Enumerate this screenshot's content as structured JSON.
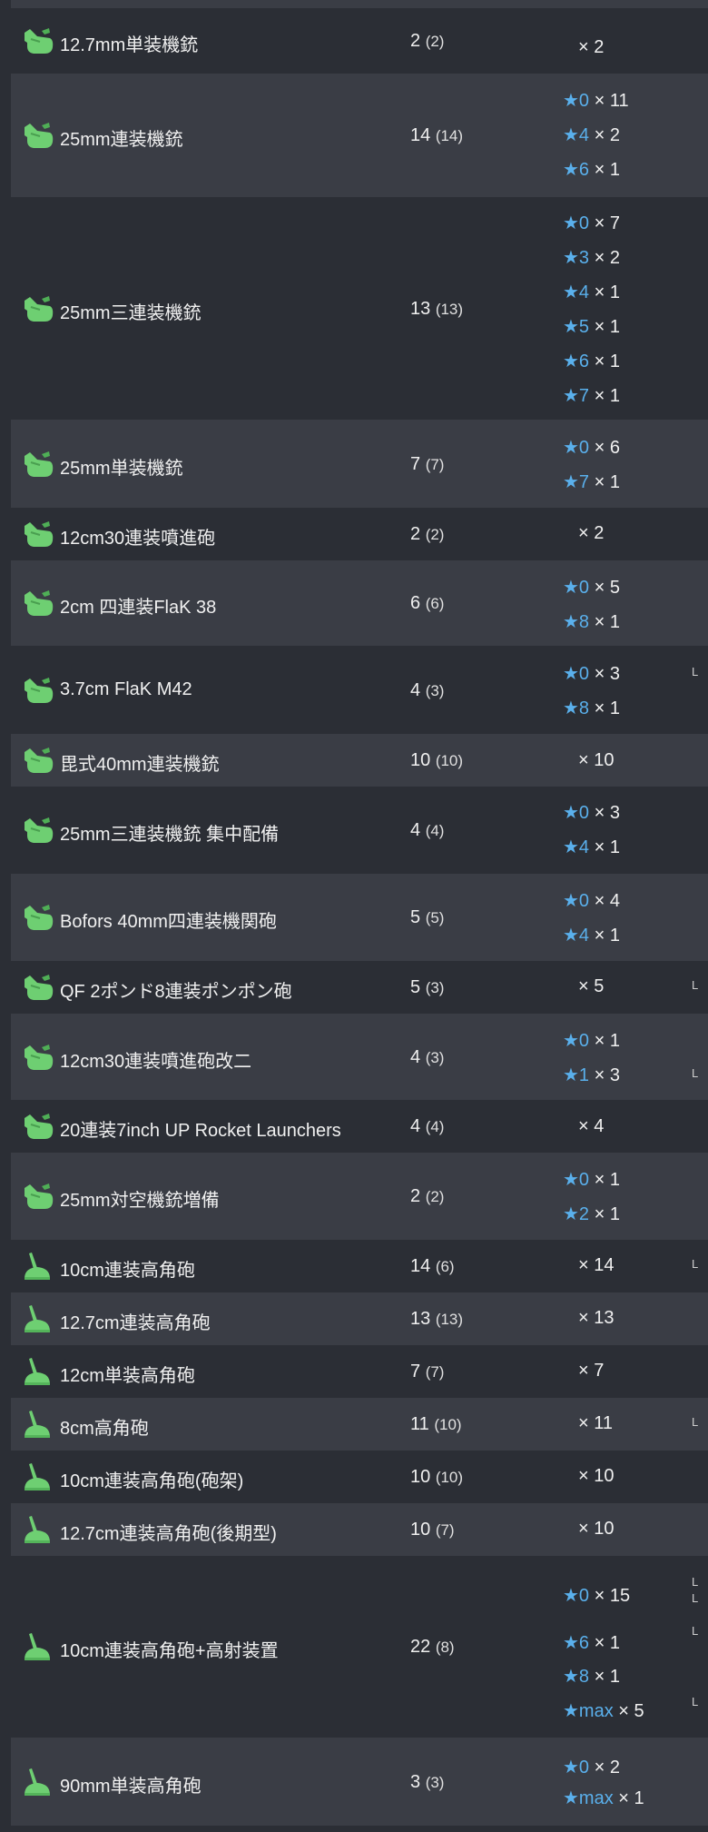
{
  "equipment": [
    {
      "name": "12.7mm単装機銃",
      "count": "2",
      "sub": "(2)",
      "icon": "machine-gun",
      "stars": [
        {
          "level": "",
          "mult": "× 2"
        }
      ]
    },
    {
      "name": "25mm連装機銃",
      "count": "14",
      "sub": "(14)",
      "icon": "machine-gun",
      "stars": [
        {
          "level": "★0",
          "mult": "× 11"
        },
        {
          "level": "★4",
          "mult": "× 2"
        },
        {
          "level": "★6",
          "mult": "× 1"
        }
      ]
    },
    {
      "name": "25mm三連装機銃",
      "count": "13",
      "sub": "(13)",
      "icon": "machine-gun",
      "stars": [
        {
          "level": "★0",
          "mult": "× 7"
        },
        {
          "level": "★3",
          "mult": "× 2"
        },
        {
          "level": "★4",
          "mult": "× 1"
        },
        {
          "level": "★5",
          "mult": "× 1"
        },
        {
          "level": "★6",
          "mult": "× 1"
        },
        {
          "level": "★7",
          "mult": "× 1"
        }
      ]
    },
    {
      "name": "25mm単装機銃",
      "count": "7",
      "sub": "(7)",
      "icon": "machine-gun",
      "stars": [
        {
          "level": "★0",
          "mult": "× 6"
        },
        {
          "level": "★7",
          "mult": "× 1"
        }
      ]
    },
    {
      "name": "12cm30連装噴進砲",
      "count": "2",
      "sub": "(2)",
      "icon": "machine-gun",
      "stars": [
        {
          "level": "",
          "mult": "× 2"
        }
      ]
    },
    {
      "name": "2cm 四連装FlaK 38",
      "count": "6",
      "sub": "(6)",
      "icon": "machine-gun",
      "stars": [
        {
          "level": "★0",
          "mult": "× 5"
        },
        {
          "level": "★8",
          "mult": "× 1"
        }
      ]
    },
    {
      "name": "3.7cm FlaK M42",
      "count": "4",
      "sub": "(3)",
      "icon": "machine-gun",
      "stars": [
        {
          "level": "★0",
          "mult": "× 3"
        },
        {
          "level": "★8",
          "mult": "× 1"
        }
      ]
    },
    {
      "name": "毘式40mm連装機銃",
      "count": "10",
      "sub": "(10)",
      "icon": "machine-gun",
      "stars": [
        {
          "level": "",
          "mult": "× 10"
        }
      ]
    },
    {
      "name": "25mm三連装機銃 集中配備",
      "count": "4",
      "sub": "(4)",
      "icon": "machine-gun",
      "stars": [
        {
          "level": "★0",
          "mult": "× 3"
        },
        {
          "level": "★4",
          "mult": "× 1"
        }
      ]
    },
    {
      "name": "Bofors 40mm四連装機関砲",
      "count": "5",
      "sub": "(5)",
      "icon": "machine-gun",
      "stars": [
        {
          "level": "★0",
          "mult": "× 4"
        },
        {
          "level": "★4",
          "mult": "× 1"
        }
      ]
    },
    {
      "name": "QF 2ポンド8連装ポンポン砲",
      "count": "5",
      "sub": "(3)",
      "icon": "machine-gun",
      "stars": [
        {
          "level": "",
          "mult": "× 5"
        }
      ]
    },
    {
      "name": "12cm30連装噴進砲改二",
      "count": "4",
      "sub": "(3)",
      "icon": "machine-gun",
      "stars": [
        {
          "level": "★0",
          "mult": "× 1"
        },
        {
          "level": "★1",
          "mult": "× 3"
        }
      ]
    },
    {
      "name": "20連装7inch UP Rocket Launchers",
      "count": "4",
      "sub": "(4)",
      "icon": "machine-gun",
      "stars": [
        {
          "level": "",
          "mult": "× 4"
        }
      ]
    },
    {
      "name": "25mm対空機銃増備",
      "count": "2",
      "sub": "(2)",
      "icon": "machine-gun",
      "stars": [
        {
          "level": "★0",
          "mult": "× 1"
        },
        {
          "level": "★2",
          "mult": "× 1"
        }
      ]
    },
    {
      "name": "10cm連装高角砲",
      "count": "14",
      "sub": "(6)",
      "icon": "high-angle-gun",
      "stars": [
        {
          "level": "",
          "mult": "× 14"
        }
      ]
    },
    {
      "name": "12.7cm連装高角砲",
      "count": "13",
      "sub": "(13)",
      "icon": "high-angle-gun",
      "stars": [
        {
          "level": "",
          "mult": "× 13"
        }
      ]
    },
    {
      "name": "12cm単装高角砲",
      "count": "7",
      "sub": "(7)",
      "icon": "high-angle-gun",
      "stars": [
        {
          "level": "",
          "mult": "× 7"
        }
      ]
    },
    {
      "name": "8cm高角砲",
      "count": "11",
      "sub": "(10)",
      "icon": "high-angle-gun",
      "stars": [
        {
          "level": "",
          "mult": "× 11"
        }
      ]
    },
    {
      "name": "10cm連装高角砲(砲架)",
      "count": "10",
      "sub": "(10)",
      "icon": "high-angle-gun",
      "stars": [
        {
          "level": "",
          "mult": "× 10"
        }
      ]
    },
    {
      "name": "12.7cm連装高角砲(後期型)",
      "count": "10",
      "sub": "(7)",
      "icon": "high-angle-gun",
      "stars": [
        {
          "level": "",
          "mult": "× 10"
        }
      ]
    },
    {
      "name": "10cm連装高角砲+高射装置",
      "count": "22",
      "sub": "(8)",
      "icon": "high-angle-gun",
      "stars": [
        {
          "level": "★0",
          "mult": "× 15"
        },
        {
          "level": "★6",
          "mult": "× 1"
        },
        {
          "level": "★8",
          "mult": "× 1"
        },
        {
          "level": "★max",
          "mult": "× 5"
        }
      ]
    },
    {
      "name": "90mm単装高角砲",
      "count": "3",
      "sub": "(3)",
      "icon": "high-angle-gun",
      "stars": [
        {
          "level": "★0",
          "mult": "× 2"
        },
        {
          "level": "★max",
          "mult": "× 1"
        }
      ]
    }
  ],
  "colors": {
    "background": "#2b2e35",
    "alt_row": "#3a3d45",
    "star_blue": "#5ab0ec",
    "icon_green": "#6ecf72"
  }
}
